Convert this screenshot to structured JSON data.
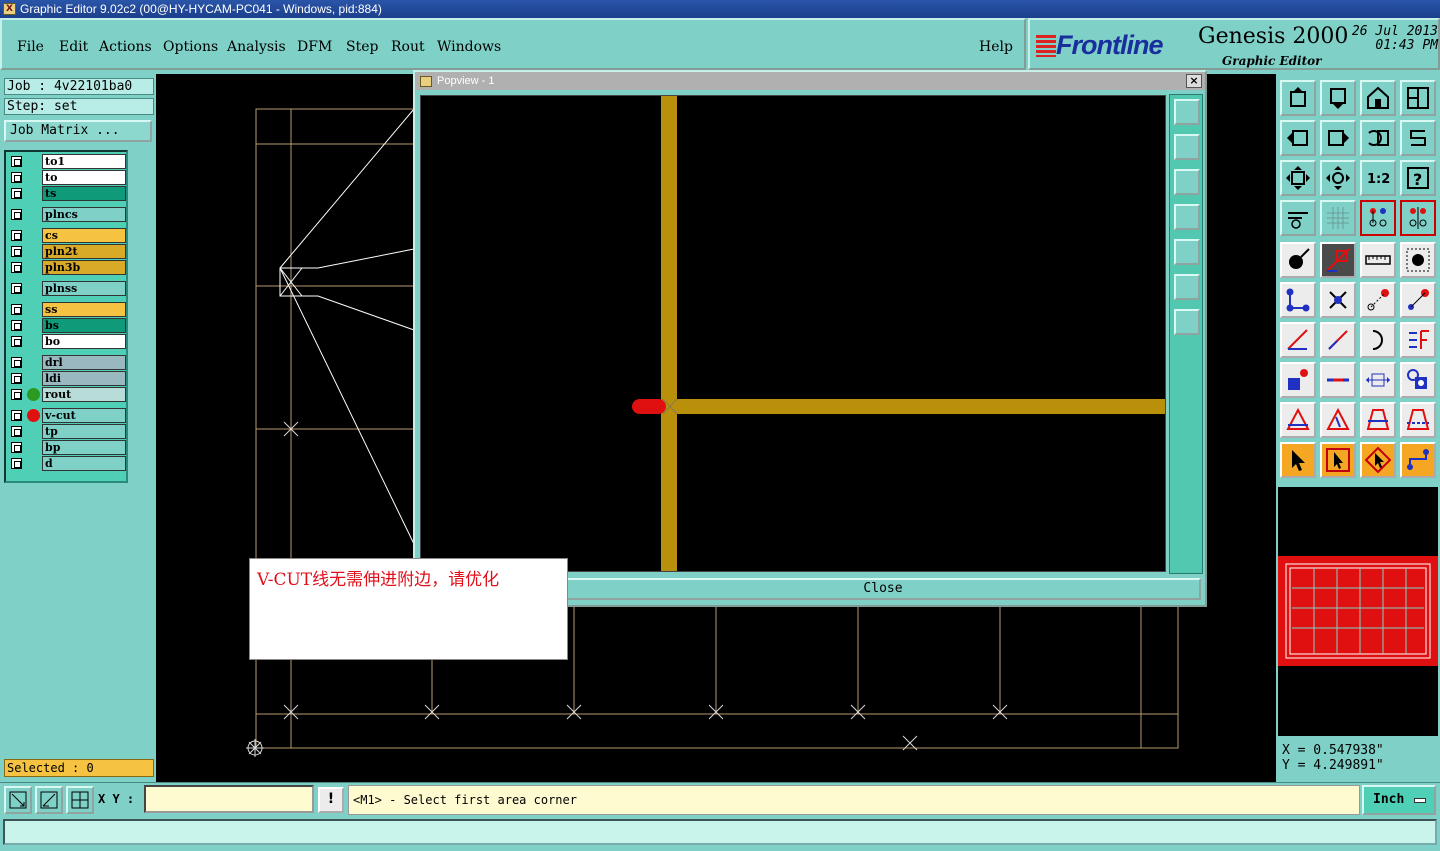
{
  "window": {
    "title": "Graphic Editor 9.02c2 (00@HY-HYCAM-PC041 - Windows, pid:884)",
    "icon_text": "X"
  },
  "menu": {
    "items": [
      "File",
      "Edit",
      "Actions",
      "Options",
      "Analysis",
      "DFM",
      "Step",
      "Rout",
      "Windows"
    ],
    "help": "Help"
  },
  "brand": {
    "logo": "Frontline",
    "product": "Genesis 2000",
    "subtitle": "Graphic Editor",
    "date": "26 Jul 2013",
    "time": "01:43 PM"
  },
  "job": {
    "job_label": "Job : 4v22101ba0",
    "step_label": "Step: set",
    "job_matrix_button": "Job Matrix ..."
  },
  "layers": [
    {
      "name": "to1",
      "color": "#ffffff",
      "dot": ""
    },
    {
      "name": "to",
      "color": "#ffffff",
      "dot": ""
    },
    {
      "name": "ts",
      "color": "#0f9a7a",
      "dot": ""
    },
    {
      "name": "plncs",
      "color": "#7fd1c8",
      "dot": ""
    },
    {
      "name": "cs",
      "color": "#f5c242",
      "dot": ""
    },
    {
      "name": "pln2t",
      "color": "#d9a928",
      "dot": ""
    },
    {
      "name": "pln3b",
      "color": "#d9a928",
      "dot": ""
    },
    {
      "name": "plnss",
      "color": "#7fd1c8",
      "dot": ""
    },
    {
      "name": "ss",
      "color": "#f5c242",
      "dot": ""
    },
    {
      "name": "bs",
      "color": "#0f9a7a",
      "dot": ""
    },
    {
      "name": "bo",
      "color": "#ffffff",
      "dot": ""
    },
    {
      "name": "drl",
      "color": "#9ab8c0",
      "dot": ""
    },
    {
      "name": "ldi",
      "color": "#9ab8c0",
      "dot": ""
    },
    {
      "name": "rout",
      "color": "#b8dcd8",
      "dot": "#2a9a20"
    },
    {
      "name": "v-cut",
      "color": "#7fd1c8",
      "dot": "#e01010"
    },
    {
      "name": "tp",
      "color": "#7fd1c8",
      "dot": ""
    },
    {
      "name": "bp",
      "color": "#7fd1c8",
      "dot": ""
    },
    {
      "name": "d",
      "color": "#7fd1c8",
      "dot": ""
    }
  ],
  "selected": "Selected : 0",
  "popview": {
    "title": "Popview - 1",
    "close_button": "Close",
    "close_icon": "×"
  },
  "note": {
    "text": "V-CUT线无需伸进附边，请优化"
  },
  "coords": {
    "x": "X = 0.547938\"",
    "y": "Y = 4.249891\""
  },
  "status": {
    "xy_label": "X Y :",
    "xy_value": "",
    "prompt": "<M1> - Select first area corner",
    "units": "Inch",
    "bang": "!"
  },
  "colors": {
    "accent": "#7fd1c8",
    "trace": "#b8900c",
    "highlight": "#e01010"
  }
}
